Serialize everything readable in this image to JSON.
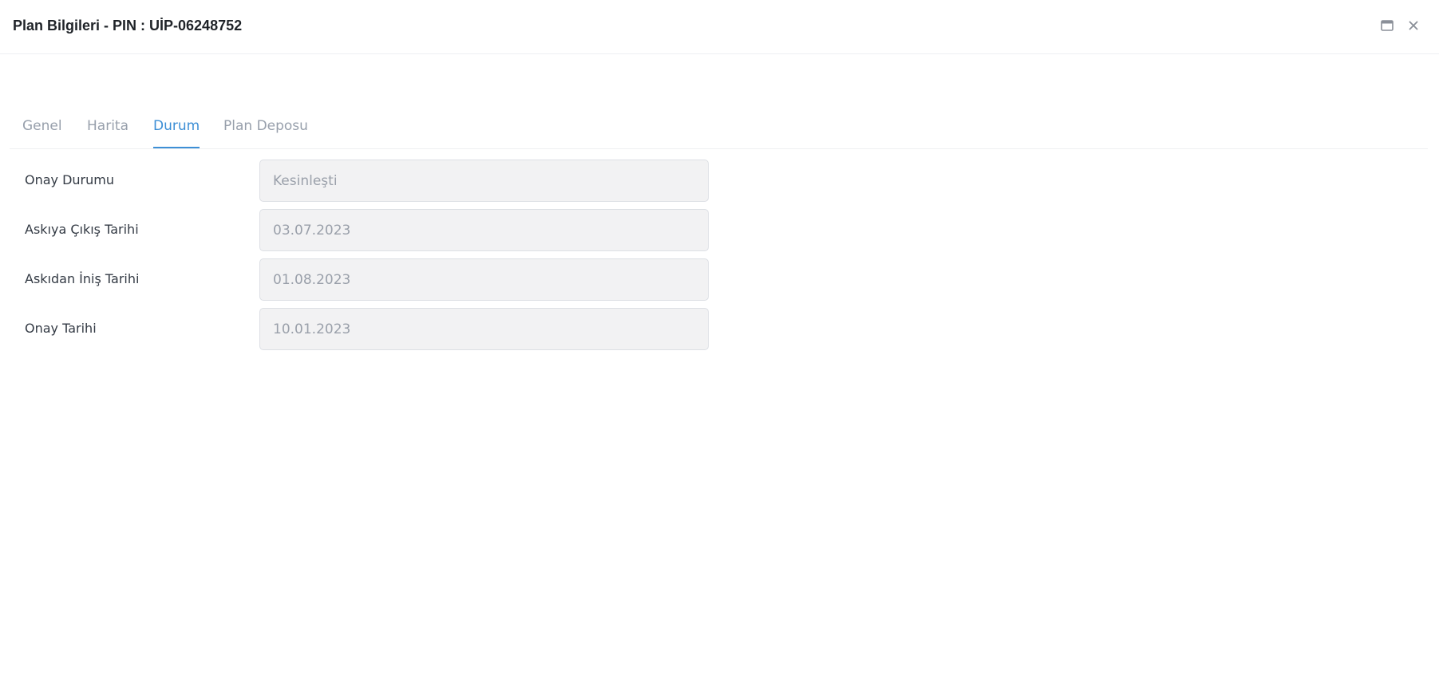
{
  "dialog": {
    "title": "Plan Bilgileri - PIN : UİP-06248752"
  },
  "tabs": [
    {
      "label": "Genel"
    },
    {
      "label": "Harita"
    },
    {
      "label": "Durum"
    },
    {
      "label": "Plan Deposu"
    }
  ],
  "active_tab": "Durum",
  "form": {
    "fields": [
      {
        "label": "Onay Durumu",
        "value": "Kesinleşti"
      },
      {
        "label": "Askıya Çıkış Tarihi",
        "value": "03.07.2023"
      },
      {
        "label": "Askıdan İniş Tarihi",
        "value": "01.08.2023"
      },
      {
        "label": "Onay Tarihi",
        "value": "10.01.2023"
      }
    ]
  },
  "icons": {
    "maximize": "maximize-icon",
    "close": "close-icon"
  },
  "colors": {
    "accent": "#3d8fd6",
    "tab_inactive": "#98a0ac",
    "field_background": "#f2f2f3",
    "field_text": "#9aa0aa"
  }
}
